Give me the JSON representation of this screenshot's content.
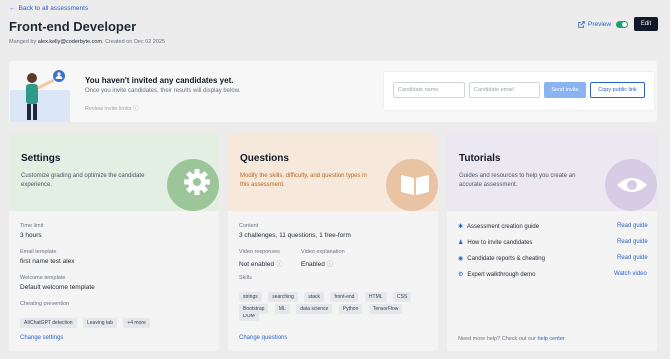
{
  "header": {
    "back_label": "Back to all assessments",
    "title": "Front-end Developer",
    "managed_prefix": "Manged by",
    "managed_email": "alex.kelly@coderbyte.com",
    "managed_suffix": ". Created on Dec 02 2025",
    "preview_label": "Preview",
    "edit_label": "Edit"
  },
  "invite": {
    "title": "You haven't invited any candidates yet.",
    "subtitle": "Once you invite candidates, their results will display below.",
    "limits_label": "Review invite limits",
    "name_placeholder": "Candidate name",
    "email_placeholder": "Candidate email",
    "send_label": "Send invite",
    "copy_label": "Copy public link"
  },
  "settings": {
    "title": "Settings",
    "description": "Customize grading and optimize the candidate experience.",
    "time_limit_label": "Time limit",
    "time_limit_value": "3 hours",
    "email_template_label": "Email template",
    "email_template_value": "first name test alex",
    "welcome_template_label": "Welcome template",
    "welcome_template_value": "Default welcome template",
    "cheating_label": "Cheating prevention",
    "cheating_chips": [
      "AI/ChatGPT detection",
      "Leaving tab",
      "+4 more"
    ],
    "change_label": "Change settings"
  },
  "questions": {
    "title": "Questions",
    "description": "Modify the skills, difficulty, and question types in this assessment.",
    "content_label": "Content",
    "content_value": "3 challenges, 11 questions, 1 free-form",
    "video_responses_label": "Video responses",
    "video_responses_value": "Not enabled",
    "video_explanation_label": "Video explanation",
    "video_explanation_value": "Enabled",
    "skills_label": "Skills",
    "skills_row1": [
      "strings",
      "searching",
      "stack",
      "front-end",
      "HTML",
      "CSS",
      "DOM"
    ],
    "skills_row2": [
      "Bootstrap",
      "ML",
      "data science",
      "Python",
      "TensorFlow"
    ],
    "change_label": "Change questions"
  },
  "tutorials": {
    "title": "Tutorials",
    "description": "Guides and resources to help you create an accurate assessment.",
    "items": [
      {
        "label": "Assessment creation guide",
        "action": "Read guide"
      },
      {
        "label": "How to invite candidates",
        "action": "Read guide"
      },
      {
        "label": "Candidate reports & cheating",
        "action": "Read guide"
      },
      {
        "label": "Expert walkthrough demo",
        "action": "Watch video"
      }
    ],
    "help_prefix": "Need more help? Check out our",
    "help_link": "help center"
  },
  "colors": {
    "accent": "#2a64c8",
    "settings_tint": "#e3efe3",
    "questions_tint": "#f6e9dc",
    "tutorials_tint": "#ece8f2",
    "toggle_on": "#1aa36b"
  }
}
